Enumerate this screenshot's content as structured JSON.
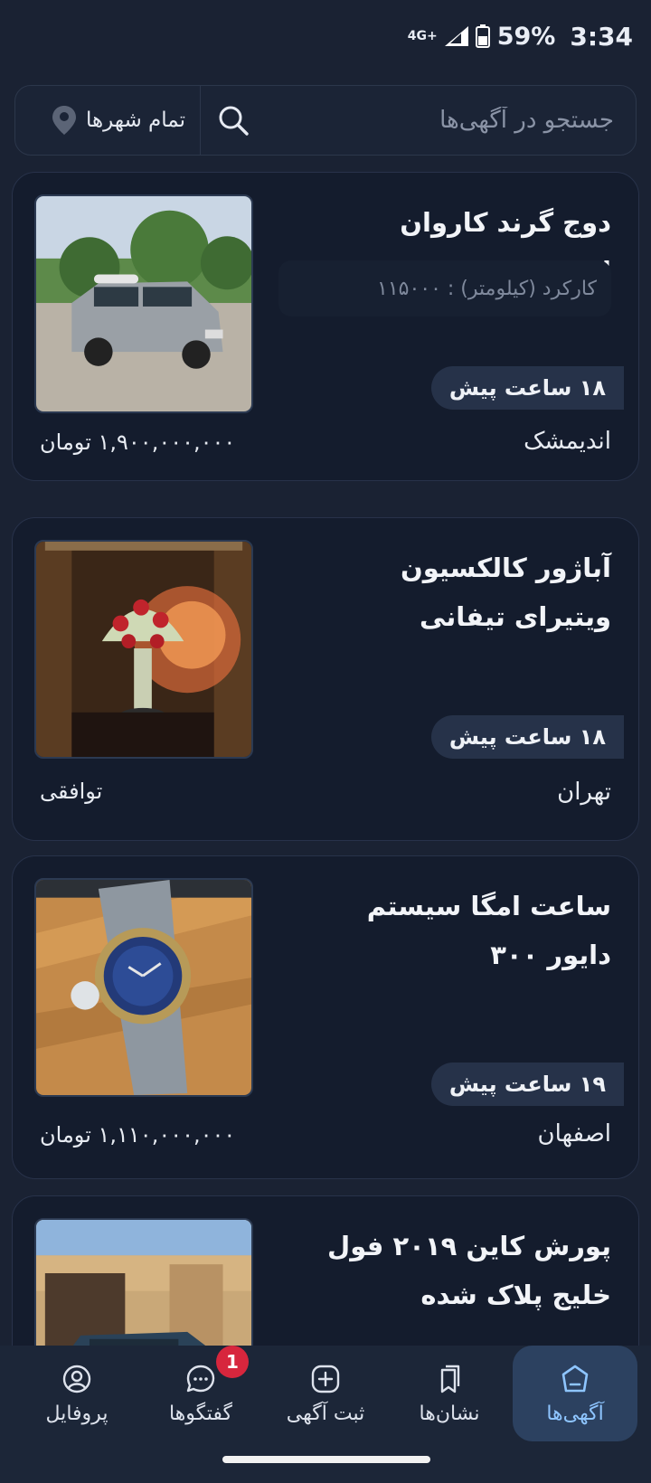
{
  "status_bar": {
    "network": "4G+",
    "battery": "59%",
    "time": "3:34"
  },
  "search": {
    "placeholder": "جستجو در آگهی‌ها",
    "city_filter": "تمام شهرها"
  },
  "listings": [
    {
      "title": "دوج گرند کاروان امریکایی",
      "mileage": "کارکرد (کیلومتر) : ۱۱۵۰۰۰",
      "time": "۱۸ ساعت پیش",
      "city": "اندیمشک",
      "price": "۱,۹۰۰,۰۰۰,۰۰۰ تومان"
    },
    {
      "title": "آباژور کالکسیون ویتیرای تیفانی",
      "time": "۱۸ ساعت پیش",
      "city": "تهران",
      "price": "توافقی"
    },
    {
      "title": "ساعت امگا سیستم دایور ۳۰۰",
      "time": "۱۹ ساعت پیش",
      "city": "اصفهان",
      "price": "۱,۱۱۰,۰۰۰,۰۰۰ تومان"
    },
    {
      "title": "پورش کاین ۲۰۱۹ فول خلیج پلاک شده"
    }
  ],
  "bottom_nav": {
    "items": [
      {
        "label": "آگهی‌ها",
        "icon": "home-icon",
        "active": true
      },
      {
        "label": "نشان‌ها",
        "icon": "bookmark-icon"
      },
      {
        "label": "ثبت آگهی",
        "icon": "add-icon"
      },
      {
        "label": "گفتگوها",
        "icon": "chat-icon",
        "badge": "1"
      },
      {
        "label": "پروفایل",
        "icon": "profile-icon"
      }
    ]
  },
  "colors": {
    "background": "#1a2233",
    "card": "#141c2d",
    "active_nav": "#2c4160",
    "accent": "#8ec5ff",
    "badge": "#d7263d"
  }
}
